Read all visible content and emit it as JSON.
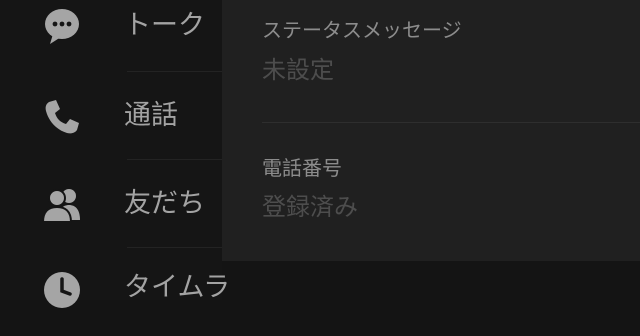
{
  "sidebar": {
    "items": [
      {
        "label": "トーク",
        "icon": "chat-bubble-icon"
      },
      {
        "label": "通話",
        "icon": "phone-icon"
      },
      {
        "label": "友だち",
        "icon": "friends-icon"
      },
      {
        "label": "タイムラ",
        "icon": "clock-icon"
      }
    ]
  },
  "profile": {
    "status_message": {
      "label": "ステータスメッセージ",
      "value": "未設定"
    },
    "phone_number": {
      "label": "電話番号",
      "value": "登録済み"
    }
  },
  "colors": {
    "background": "#141414",
    "panel": "#202020",
    "icon": "#a5a5a5",
    "label_text": "#8c8c8c",
    "value_text": "#4d4d4d"
  }
}
